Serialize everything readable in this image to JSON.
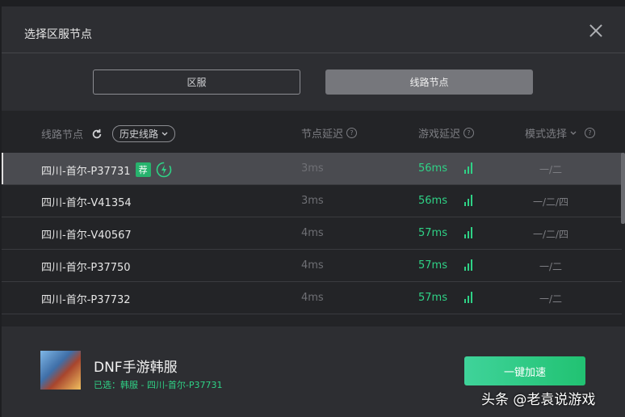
{
  "dialog": {
    "title": "选择区服节点"
  },
  "segments": {
    "region": "区服",
    "node": "线路节点"
  },
  "header": {
    "node": "线路节点",
    "history": "历史线路",
    "node_delay": "节点延迟",
    "game_delay": "游戏延迟",
    "mode": "模式选择"
  },
  "rows": [
    {
      "name": "四川-首尔-P37731",
      "tag": "荐",
      "node_delay": "3ms",
      "game_delay": "56ms",
      "mode": "一/二"
    },
    {
      "name": "四川-首尔-V41354",
      "node_delay": "3ms",
      "game_delay": "56ms",
      "mode": "一/二/四"
    },
    {
      "name": "四川-首尔-V40567",
      "node_delay": "4ms",
      "game_delay": "57ms",
      "mode": "一/二/四"
    },
    {
      "name": "四川-首尔-P37750",
      "node_delay": "4ms",
      "game_delay": "57ms",
      "mode": "一/二"
    },
    {
      "name": "四川-首尔-P37732",
      "node_delay": "4ms",
      "game_delay": "57ms",
      "mode": "一/二"
    }
  ],
  "footer": {
    "game_title": "DNF手游韩服",
    "selected": "已选：韩服 - 四川-首尔-P37731",
    "boost": "一键加速"
  },
  "watermark": "头条 @老袁说游戏",
  "colors": {
    "accent": "#2fd286",
    "tag": "#27b36d"
  }
}
